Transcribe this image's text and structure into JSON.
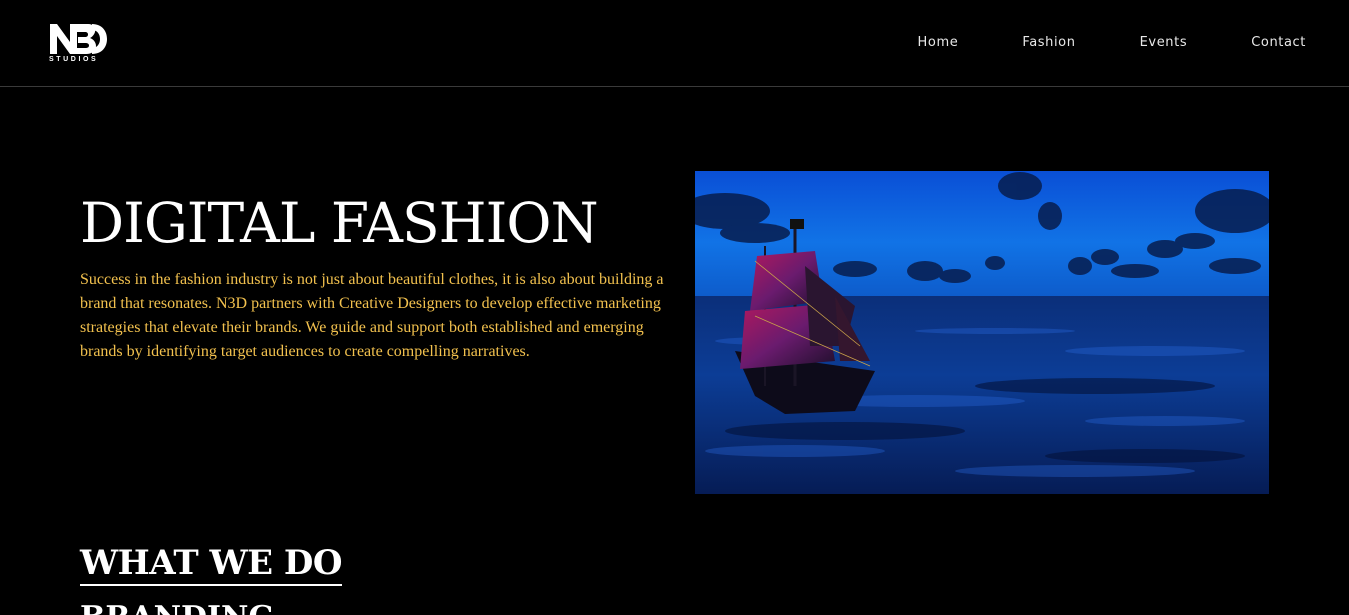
{
  "header": {
    "logo": {
      "mark": "N3D",
      "subtitle": "STUDIOS"
    },
    "nav": [
      {
        "label": "Home"
      },
      {
        "label": "Fashion"
      },
      {
        "label": "Events"
      },
      {
        "label": "Contact"
      }
    ]
  },
  "hero": {
    "title": "DIGITAL FASHION",
    "body": "Success in the fashion industry is not just about beautiful clothes, it is also about building a brand that resonates. N3D partners with Creative Designers to develop effective marketing strategies that elevate their brands. We guide and support both established and emerging brands by identifying target audiences to create compelling narratives.",
    "image": {
      "icon": "pirate-ship-ocean-image"
    }
  },
  "section": {
    "title": "WHAT WE DO",
    "next_heading": "BRANDING"
  },
  "colors": {
    "background": "#000000",
    "text": "#ffffff",
    "accent": "#f2c14e",
    "divider": "#3a3a3a"
  }
}
